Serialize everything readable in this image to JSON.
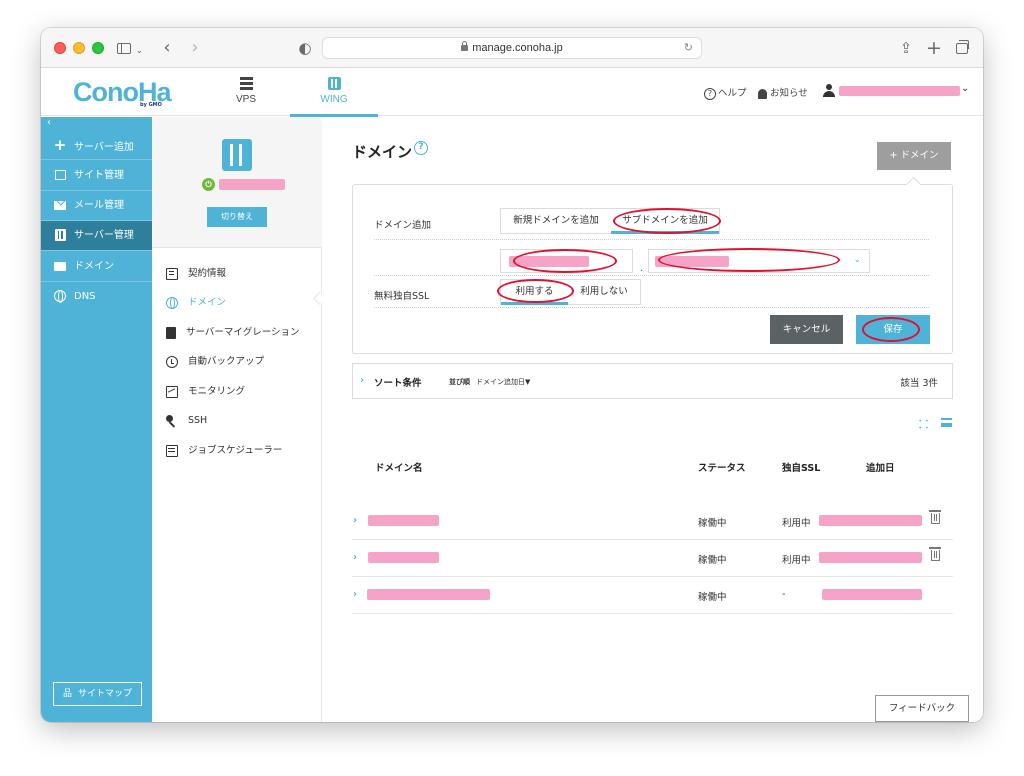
{
  "browser": {
    "url": "manage.conoha.jp"
  },
  "header": {
    "logo_text": "ConoHa",
    "logo_sub": "by GMO",
    "nav": [
      {
        "label": "VPS",
        "icon": "server-stack-icon"
      },
      {
        "label": "WING",
        "icon": "wing-server-icon",
        "active": true
      }
    ],
    "help_label": "ヘルプ",
    "notifications_label": "お知らせ",
    "user_name_redacted": true
  },
  "sidebar": {
    "collapse_label": "‹",
    "items": [
      {
        "label": "サーバー追加",
        "icon": "plus-icon"
      },
      {
        "label": "サイト管理",
        "icon": "site-icon"
      },
      {
        "label": "メール管理",
        "icon": "mail-icon"
      },
      {
        "label": "サーバー管理",
        "icon": "server-icon",
        "active": true
      },
      {
        "label": "ドメイン",
        "icon": "domain-icon"
      },
      {
        "label": "DNS",
        "icon": "globe-icon"
      }
    ],
    "sitemap_label": "サイトマップ"
  },
  "server_panel": {
    "switch_label": "切り替え",
    "status": "running",
    "menu": [
      {
        "label": "契約情報",
        "icon": "contract-icon"
      },
      {
        "label": "ドメイン",
        "icon": "globe-icon",
        "active": true
      },
      {
        "label": "サーバーマイグレーション",
        "icon": "migration-icon"
      },
      {
        "label": "自動バックアップ",
        "icon": "backup-clock-icon"
      },
      {
        "label": "モニタリング",
        "icon": "monitoring-icon"
      },
      {
        "label": "SSH",
        "icon": "key-icon"
      },
      {
        "label": "ジョブスケジューラー",
        "icon": "scheduler-icon"
      }
    ]
  },
  "main": {
    "title": "ドメイン",
    "help_icon": "?",
    "add_domain_label": "+ ドメイン",
    "form": {
      "domain_add_label": "ドメイン追加",
      "domain_add_options": [
        "新規ドメインを追加",
        "サブドメインを追加"
      ],
      "domain_add_selected": "サブドメインを追加",
      "separator": ".",
      "ssl_label": "無料独自SSL",
      "ssl_options": [
        "利用する",
        "利用しない"
      ],
      "ssl_selected": "利用する",
      "cancel_label": "キャンセル",
      "save_label": "保存"
    },
    "sort": {
      "label": "ソート条件",
      "order_label": "並び順",
      "order_value": "ドメイン追加日▼",
      "count": "該当 3件"
    },
    "table": {
      "headers": [
        "ドメイン名",
        "ステータス",
        "独自SSL",
        "追加日"
      ],
      "rows": [
        {
          "status": "稼働中",
          "ssl": "利用中",
          "deletable": true
        },
        {
          "status": "稼働中",
          "ssl": "利用中",
          "deletable": true
        },
        {
          "status": "稼働中",
          "ssl": "-",
          "deletable": false
        }
      ]
    },
    "feedback_label": "フィードバック"
  },
  "colors": {
    "accent": "#4fb3d8",
    "sidebar_active": "#2d7f9b",
    "redaction": "#f5a3c7",
    "annotation": "#e0102f"
  }
}
